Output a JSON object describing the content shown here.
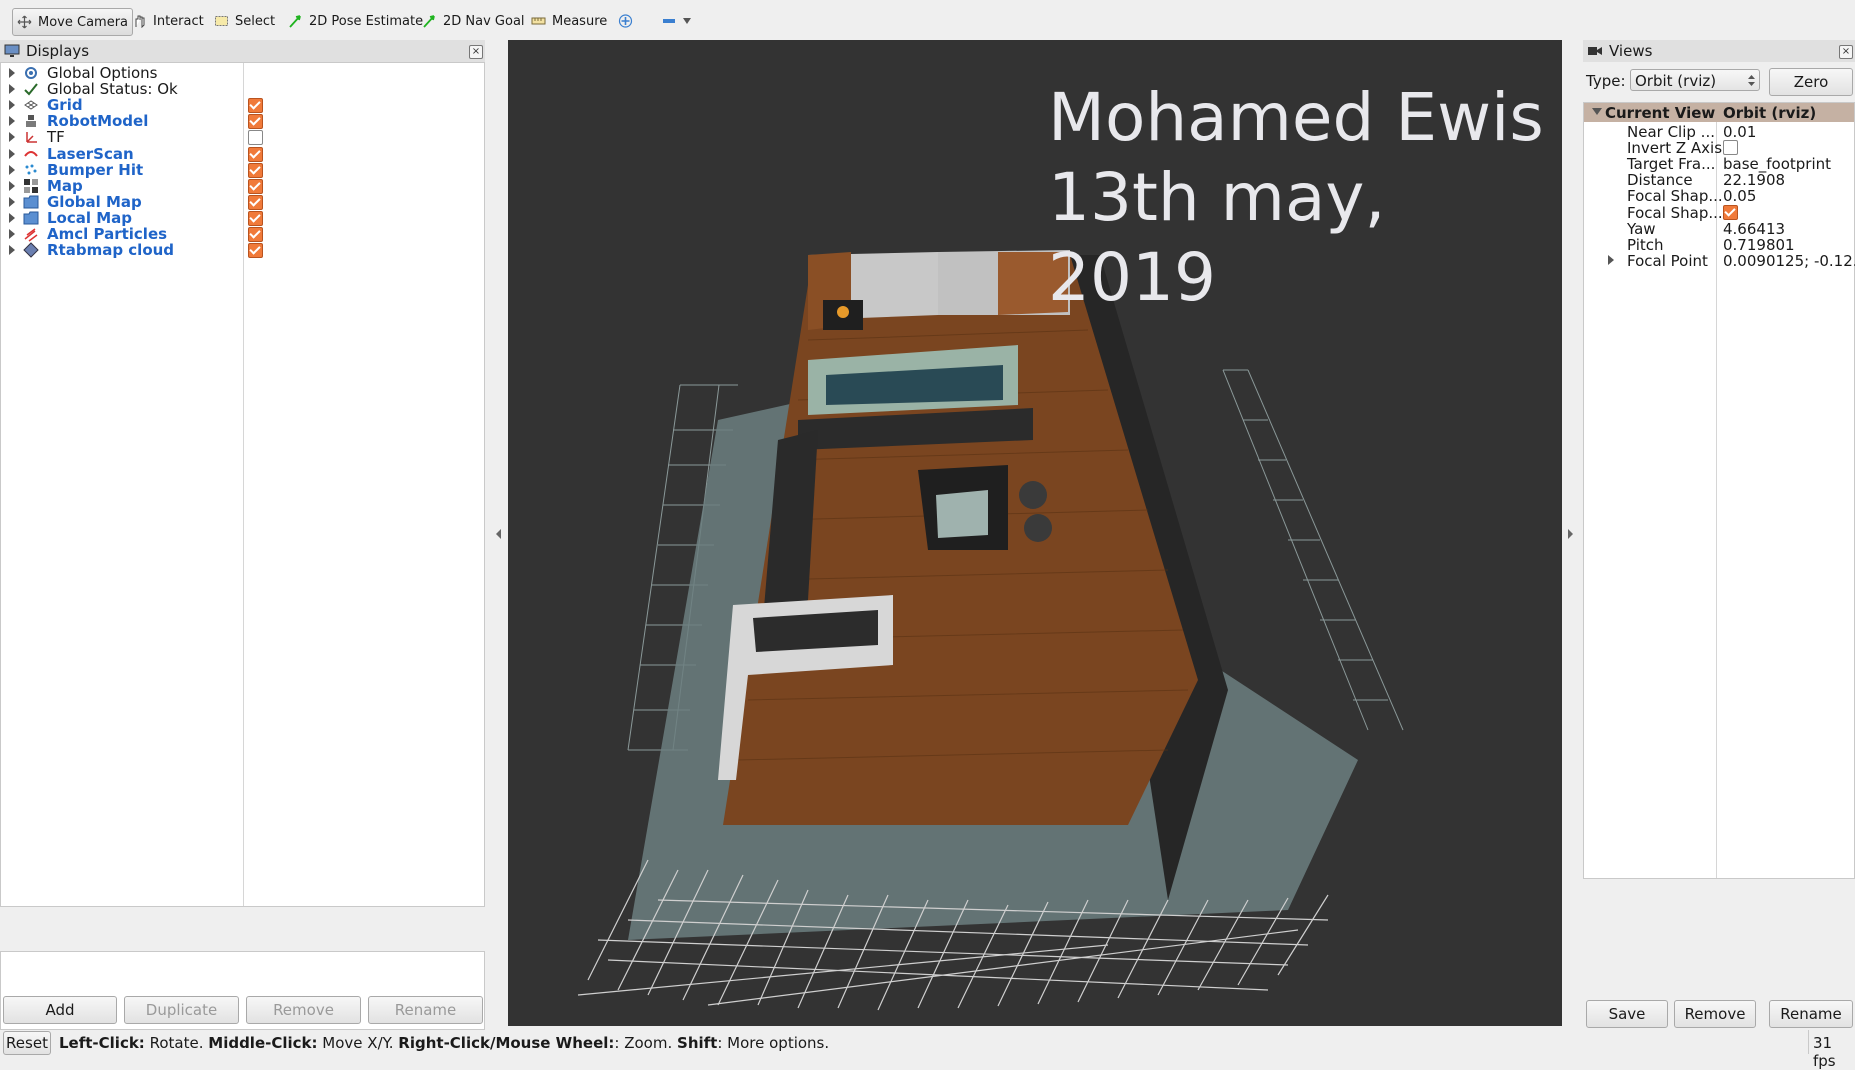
{
  "toolbar": {
    "tools": [
      {
        "label": "Move Camera",
        "icon": "move-camera-icon",
        "active": true
      },
      {
        "label": "Interact",
        "icon": "hand-icon"
      },
      {
        "label": "Select",
        "icon": "select-icon"
      },
      {
        "label": "2D Pose Estimate",
        "icon": "green-arrow-icon"
      },
      {
        "label": "2D Nav Goal",
        "icon": "green-arrow-icon"
      },
      {
        "label": "Measure",
        "icon": "ruler-icon"
      }
    ]
  },
  "displays": {
    "title": "Displays",
    "items": [
      {
        "label": "Global Options",
        "icon": "gear-icon",
        "highlight": false,
        "check": null
      },
      {
        "label": "Global Status: Ok",
        "icon": "ok-check-icon",
        "highlight": false,
        "check": null
      },
      {
        "label": "Grid",
        "icon": "grid-icon",
        "highlight": true,
        "check": true
      },
      {
        "label": "RobotModel",
        "icon": "robot-model-icon",
        "highlight": true,
        "check": true
      },
      {
        "label": "TF",
        "icon": "tf-axes-icon",
        "highlight": false,
        "check": false
      },
      {
        "label": "LaserScan",
        "icon": "laser-scan-icon",
        "highlight": true,
        "check": true
      },
      {
        "label": "Bumper Hit",
        "icon": "point-cloud-icon",
        "highlight": true,
        "check": true
      },
      {
        "label": "Map",
        "icon": "map-icon",
        "highlight": true,
        "check": true
      },
      {
        "label": "Global Map",
        "icon": "folder-icon",
        "highlight": true,
        "check": true
      },
      {
        "label": "Local Map",
        "icon": "folder-icon",
        "highlight": true,
        "check": true
      },
      {
        "label": "Amcl Particles",
        "icon": "pose-array-icon",
        "highlight": true,
        "check": true
      },
      {
        "label": "Rtabmap cloud",
        "icon": "cloud-icon",
        "highlight": true,
        "check": true
      }
    ],
    "buttons": {
      "add": "Add",
      "duplicate": "Duplicate",
      "remove": "Remove",
      "rename": "Rename"
    }
  },
  "viewport": {
    "overlay_line1": "Mohamed Ewis",
    "overlay_line2": "13th may, 2019"
  },
  "views": {
    "title": "Views",
    "type_label": "Type:",
    "type_value": "Orbit (rviz)",
    "zero_label": "Zero",
    "header_name": "Current View",
    "header_value": "Orbit (rviz)",
    "props": [
      {
        "name": "Near Clip ...",
        "value": "0.01"
      },
      {
        "name": "Invert Z Axis",
        "value": "",
        "check": false
      },
      {
        "name": "Target Fra...",
        "value": "base_footprint"
      },
      {
        "name": "Distance",
        "value": "22.1908"
      },
      {
        "name": "Focal Shap...",
        "value": "0.05"
      },
      {
        "name": "Focal Shap...",
        "value": "",
        "check": true
      },
      {
        "name": "Yaw",
        "value": "4.66413"
      },
      {
        "name": "Pitch",
        "value": "0.719801"
      },
      {
        "name": "Focal Point",
        "value": "0.0090125; -0.12..."
      }
    ],
    "buttons": {
      "save": "Save",
      "remove": "Remove",
      "rename": "Rename"
    }
  },
  "status": {
    "reset": "Reset",
    "left_click": "Left-Click:",
    "left_desc": "Rotate.",
    "middle_click": "Middle-Click:",
    "middle_desc": "Move X/Y.",
    "right_click": "Right-Click/Mouse Wheel:",
    "right_desc": ": Zoom.",
    "shift": "Shift",
    "shift_desc": ": More options.",
    "fps": "31 fps"
  },
  "colors": {
    "viewport_bg": "#333333",
    "check_orange": "#f07a3a",
    "highlight_blue": "#1f64c8",
    "floor_brown": "#7a4520"
  }
}
